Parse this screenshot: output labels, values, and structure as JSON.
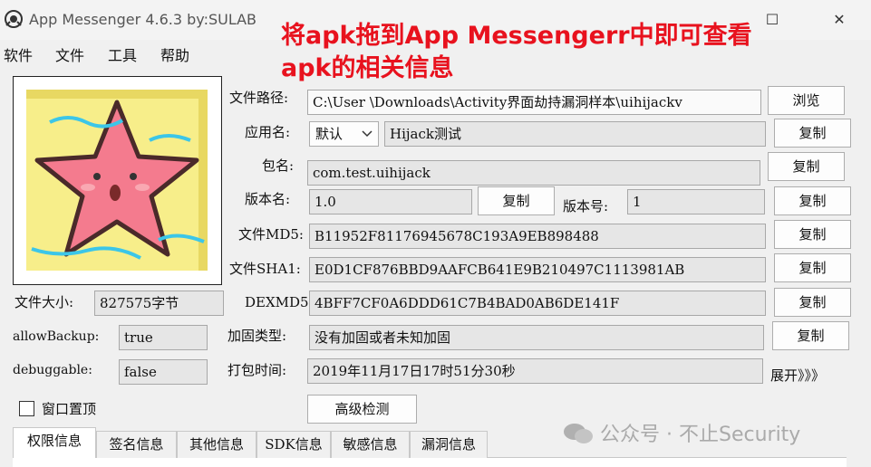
{
  "window": {
    "title": "App Messenger 4.6.3   by:SULAB",
    "minimize": "—",
    "maximize": "☐",
    "close": "✕"
  },
  "menu": [
    "软件",
    "文件",
    "工具",
    "帮助"
  ],
  "overlay": {
    "line1": "将apk拖到App Messengerr中即可查看",
    "line2": "apk的相关信息"
  },
  "fields": {
    "path_label": "文件路径:",
    "path_value": "C:\\User      \\Downloads\\Activity界面劫持漏洞样本\\uihijackv",
    "browse_btn": "浏览",
    "appname_label": "应用名:",
    "lang_select": "默认",
    "appname_value": "Hijack测试",
    "copy_btn": "复制",
    "pkg_label": "包名:",
    "pkg_value": "com.test.uihijack",
    "vername_label": "版本名:",
    "vername_value": "1.0",
    "vercode_label": "版本号:",
    "vercode_value": "1",
    "md5_label": "文件MD5:",
    "md5_value": "B11952F81176945678C193A9EB898488",
    "sha1_label": "文件SHA1:",
    "sha1_value": "E0D1CF876BBD9AAFCB641E9B210497C1113981AB",
    "dexmd5_label": "DEXMD5:",
    "dexmd5_value": "4BFF7CF0A6DDD61C7B4BAD0AB6DE141F",
    "protect_label": "加固类型:",
    "protect_value": "没有加固或者未知加固",
    "packtime_label": "打包时间:",
    "packtime_value": "2019年11月17日17时51分30秒",
    "expand": "展开》》》"
  },
  "left_info": {
    "size_label": "文件大小:",
    "size_value": "827575字节",
    "backup_label": "allowBackup:",
    "backup_value": "true",
    "debug_label": "debuggable:",
    "debug_value": "false",
    "ontop_label": "窗口置顶"
  },
  "advanced_btn": "高级检测",
  "tabs": [
    "权限信息",
    "签名信息",
    "其他信息",
    "SDK信息",
    "敏感信息",
    "漏洞信息"
  ],
  "watermark": "公众号 · 不止Security"
}
